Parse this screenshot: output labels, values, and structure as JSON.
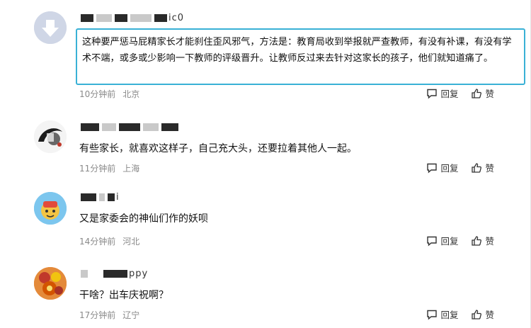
{
  "comments": [
    {
      "username": "ic0",
      "text": "这种要严惩马屁精家长才能刹住歪风邪气，方法是：教育局收到举报就严查教师，有没有补课，有没有学术不端，或多或少影响一下教师的评级晋升。让教师反过来去针对这家长的孩子，他们就知道痛了。",
      "time": "10分钟前",
      "location": "北京",
      "reply_label": "回复",
      "like_label": "赞"
    },
    {
      "username": "",
      "text": "有些家长，就喜欢这样子，自己充大头，还要拉着其他人一起。",
      "time": "11分钟前",
      "location": "上海",
      "reply_label": "回复",
      "like_label": "赞"
    },
    {
      "username": "i",
      "text": "又是家委会的神仙们作的妖呗",
      "time": "14分钟前",
      "location": "河北",
      "reply_label": "回复",
      "like_label": "赞"
    },
    {
      "username": "ppy",
      "text": "干啥？出车庆祝啊？",
      "time": "17分钟前",
      "location": "辽宁",
      "reply_label": "回复",
      "like_label": "赞"
    }
  ],
  "colors": {
    "highlight_border": "#39b1d6",
    "meta": "#8a8a8a"
  },
  "icons": {
    "reply": "comment-bubble-icon",
    "like": "thumbs-up-icon"
  }
}
